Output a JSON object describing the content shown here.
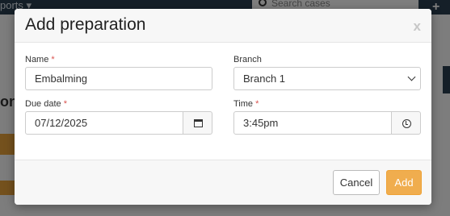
{
  "background": {
    "nav_text": "ports ▾",
    "search_placeholder": "Search cases",
    "plus_label": "+",
    "side_text": "on"
  },
  "modal": {
    "title": "Add preparation",
    "close_label": "x",
    "fields": {
      "name": {
        "label": "Name",
        "required": "*",
        "value": "Embalming"
      },
      "branch": {
        "label": "Branch",
        "value": "Branch 1"
      },
      "due_date": {
        "label": "Due date",
        "required": "*",
        "value": "07/12/2025"
      },
      "time": {
        "label": "Time",
        "required": "*",
        "value": "3:45pm"
      }
    },
    "footer": {
      "cancel_label": "Cancel",
      "add_label": "Add"
    }
  },
  "colors": {
    "accent": "#f0ad4e",
    "required": "#d9534f",
    "topbar": "#2b3e50"
  },
  "icons": {
    "calendar": "calendar-icon",
    "clock": "clock-icon",
    "chevron": "chevron-down-icon",
    "search": "search-icon"
  }
}
